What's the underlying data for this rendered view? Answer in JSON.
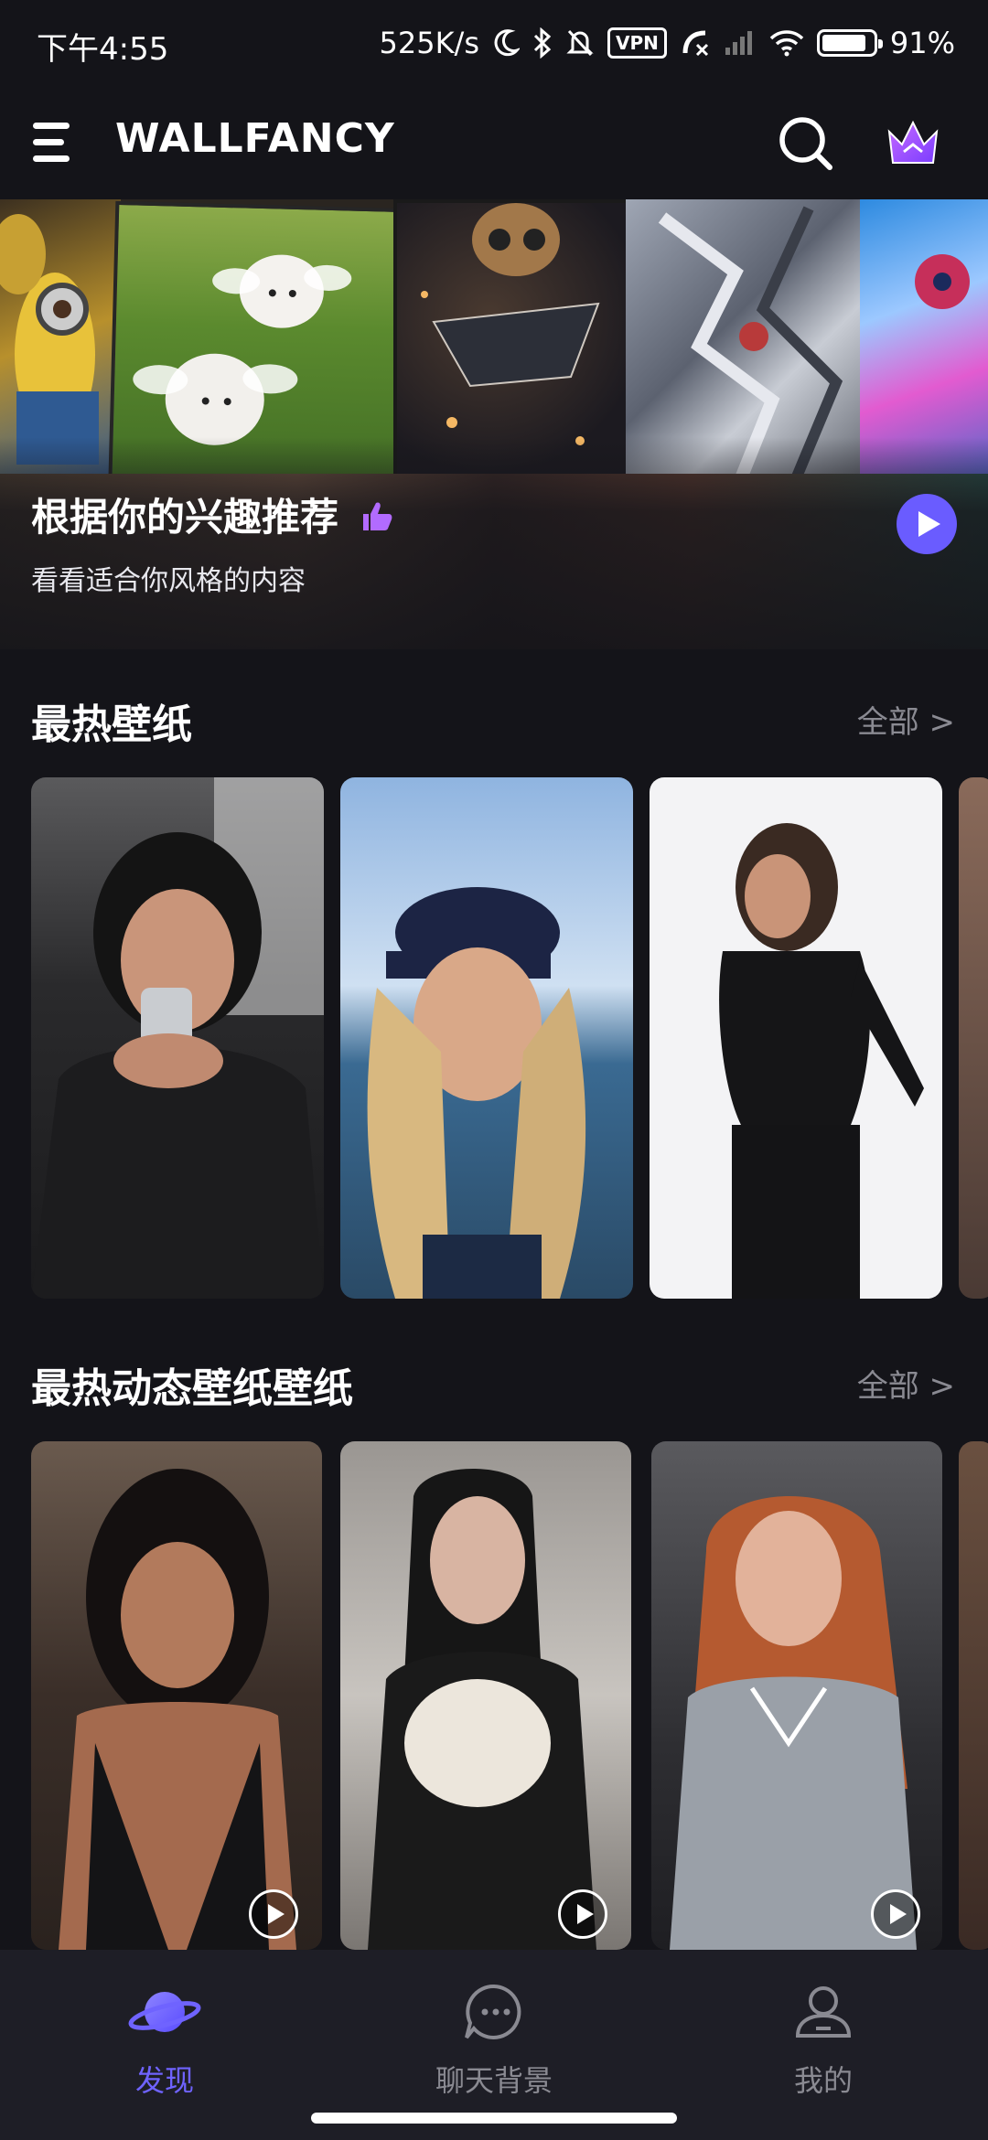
{
  "status_bar": {
    "time": "下午4:55",
    "network_speed": "525K/s",
    "vpn": "VPN",
    "battery": "91%",
    "battery_level": 0.91
  },
  "app_bar": {
    "brand": "WALLFANCY",
    "icons": [
      "menu-icon",
      "search-icon",
      "crown-icon"
    ]
  },
  "banner": {
    "title": "根据你的兴趣推荐",
    "subtitle": "看看适合你风格的内容"
  },
  "sections": [
    {
      "title": "最热壁纸",
      "see_all": "全部 >"
    },
    {
      "title": "最热动态壁纸壁纸",
      "see_all": "全部 >"
    }
  ],
  "bottom_nav": [
    {
      "label": "发现",
      "icon": "planet-icon",
      "active": true
    },
    {
      "label": "聊天背景",
      "icon": "chat-bubble-icon",
      "active": false
    },
    {
      "label": "我的",
      "icon": "user-icon",
      "active": false
    }
  ],
  "colors": {
    "background": "#141419",
    "accent": "#6f63ff",
    "muted_text": "#8a8a92",
    "nav_background": "#1e1e26"
  }
}
